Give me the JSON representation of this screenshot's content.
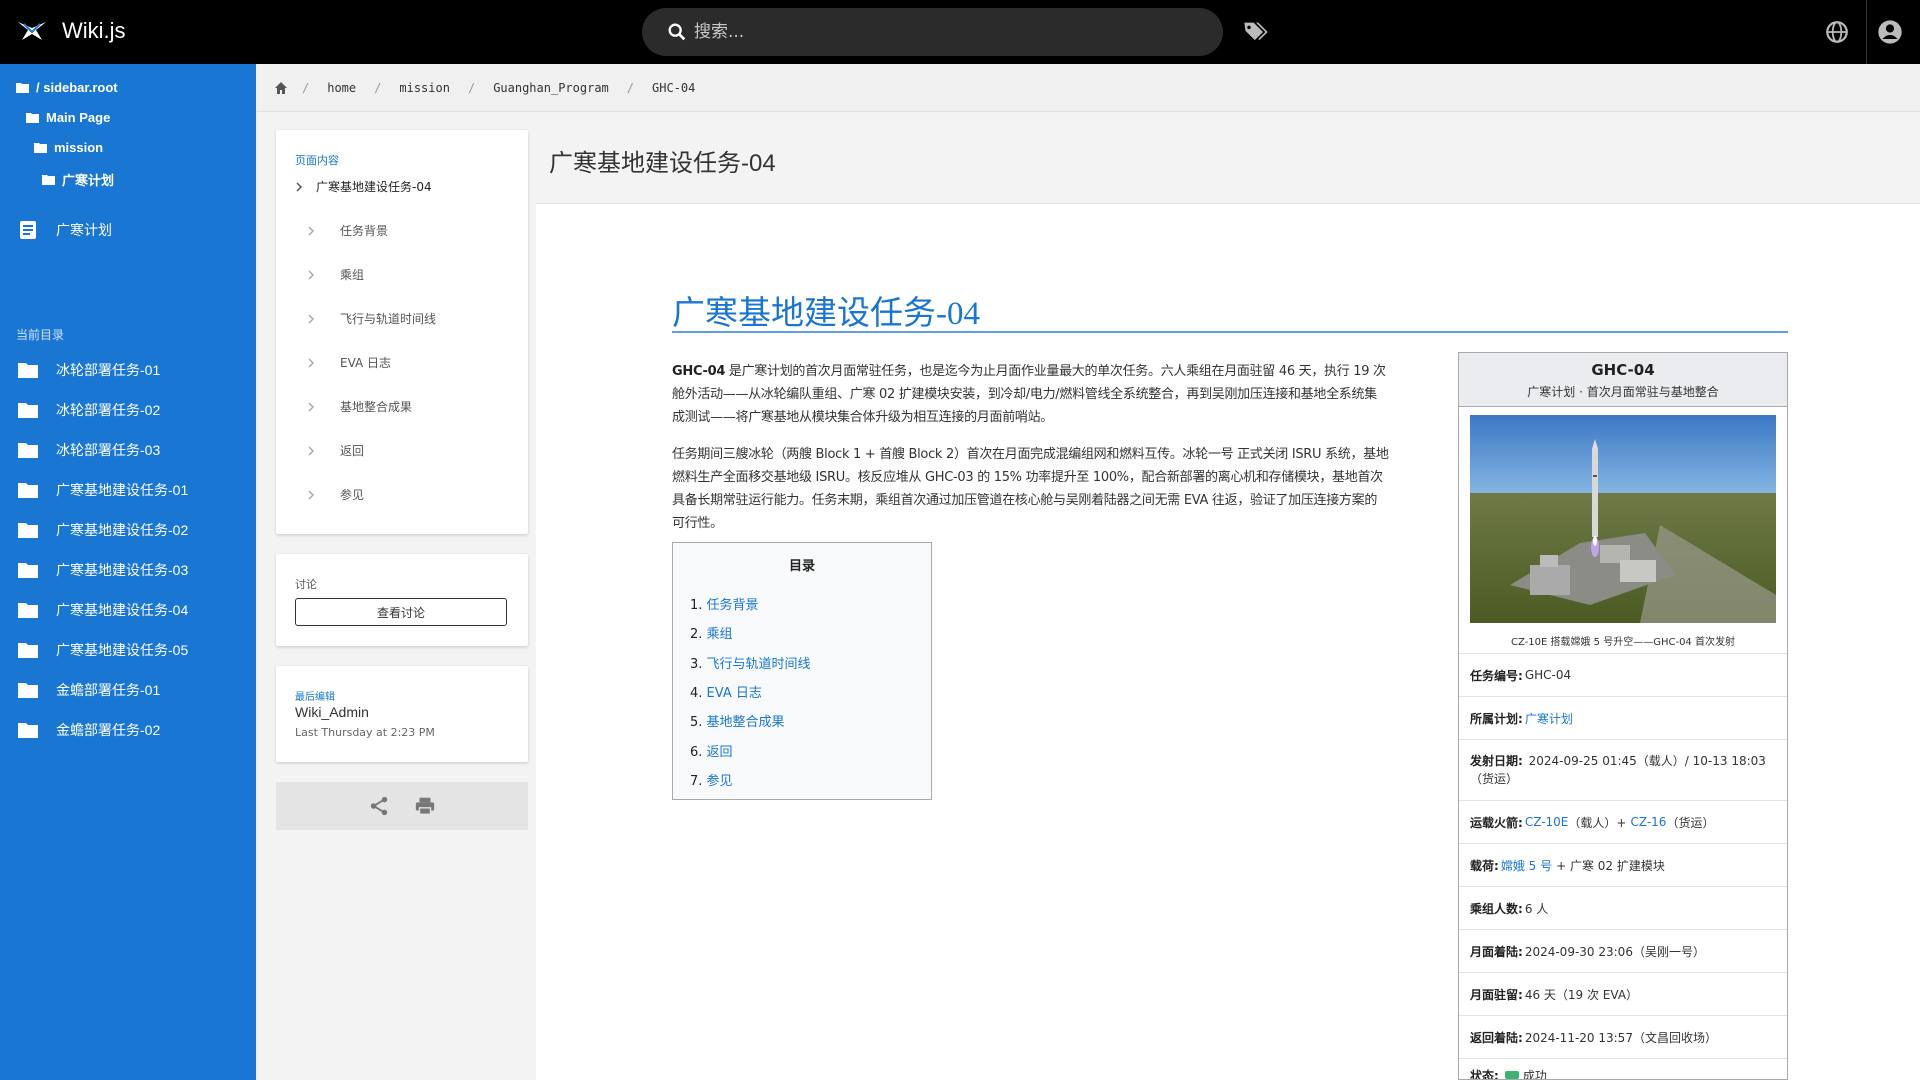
{
  "app": {
    "title": "Wiki.js"
  },
  "search": {
    "placeholder": "搜索..."
  },
  "sidebar": {
    "tree": [
      "/ sidebar.root",
      "Main Page",
      "mission",
      "广寒计划"
    ],
    "pinned": "广寒计划",
    "section_title": "当前目录",
    "items": [
      "冰轮部署任务-01",
      "冰轮部署任务-02",
      "冰轮部署任务-03",
      "广寒基地建设任务-01",
      "广寒基地建设任务-02",
      "广寒基地建设任务-03",
      "广寒基地建设任务-04",
      "广寒基地建设任务-05",
      "金蟾部署任务-01",
      "金蟾部署任务-02"
    ]
  },
  "breadcrumb": [
    "home",
    "mission",
    "Guanghan_Program",
    "GHC-04"
  ],
  "page_title": "广寒基地建设任务-04",
  "toc_panel": {
    "heading": "页面内容",
    "main": "广寒基地建设任务-04",
    "items": [
      "任务背景",
      "乘组",
      "飞行与轨道时间线",
      "EVA 日志",
      "基地整合成果",
      "返回",
      "参见"
    ]
  },
  "discussion": {
    "heading": "讨论",
    "button": "查看讨论"
  },
  "last_edit": {
    "heading": "最后编辑",
    "user": "Wiki_Admin",
    "time": "Last Thursday at 2:23 PM"
  },
  "article": {
    "heading": "广寒基地建设任务-04",
    "p1_bold": "GHC-04",
    "p1_line1": " 是广寒计划的首次月面常驻任务，也是迄今为止月面作业量最大的单次任务。六人乘组在月面驻留 46 天，执行 19 次",
    "p1_line2": "舱外活动——从冰轮编队重组、广寒 02 扩建模块安装，到冷却/电力/燃料管线全系统整合，再到吴刚加压连接和基地全系统集",
    "p1_line3": "成测试——将广寒基地从模块集合体升级为相互连接的月面前哨站。",
    "p2_line1": "任务期间三艘冰轮（两艘 Block 1 + 首艘 Block 2）首次在月面完成混编组网和燃料互传。冰轮一号 正式关闭 ISRU 系统，基地",
    "p2_line2": "燃料生产全面移交基地级 ISRU。核反应堆从 GHC-03 的 15% 功率提升至 100%，配合新部署的离心机和存储模块，基地首次",
    "p2_line3": "具备长期常驻运行能力。任务末期，乘组首次通过加压管道在核心舱与吴刚着陆器之间无需 EVA 往返，验证了加压连接方案的",
    "p2_line4": "可行性。",
    "toc_title": "目录",
    "toc": [
      {
        "num": "1.",
        "label": "任务背景"
      },
      {
        "num": "2.",
        "label": "乘组"
      },
      {
        "num": "3.",
        "label": "飞行与轨道时间线"
      },
      {
        "num": "4.",
        "label": "EVA 日志"
      },
      {
        "num": "5.",
        "label": "基地整合成果"
      },
      {
        "num": "6.",
        "label": "返回"
      },
      {
        "num": "7.",
        "label": "参见"
      }
    ]
  },
  "infobox": {
    "code": "GHC-04",
    "subtitle": "广寒计划 · 首次月面常驻与基地整合",
    "caption": "CZ-10E 搭载嫦娥 5 号升空——GHC-04 首次发射",
    "rows": {
      "mission_no": {
        "label": "任务编号:",
        "value": "GHC-04"
      },
      "program": {
        "label": "所属计划:",
        "link": "广寒计划"
      },
      "launch": {
        "label": "发射日期:",
        "value": "2024-09-25 01:45（载人）/ 10-13 18:03",
        "value2": "（货运）"
      },
      "rocket": {
        "label": "运载火箭:",
        "link1": "CZ-10E",
        "text1": "（载人）+",
        "link2": "CZ-16",
        "text2": "（货运）"
      },
      "payload": {
        "label": "载荷:",
        "link": "嫦娥 5 号",
        "value": "+ 广寒 02 扩建模块"
      },
      "crew": {
        "label": "乘组人数:",
        "value": "6 人"
      },
      "landing": {
        "label": "月面着陆:",
        "value": "2024-09-30 23:06（吴刚一号）"
      },
      "stay": {
        "label": "月面驻留:",
        "value": "46 天（19 次 EVA）"
      },
      "return": {
        "label": "返回着陆:",
        "value": "2024-11-20 13:57（文昌回收场）"
      },
      "status": {
        "label": "状态:",
        "value": "成功"
      }
    }
  },
  "colors": {
    "accent": "#1976d2",
    "topbar": "#000000",
    "sidebar": "#1976d2",
    "success": "#3cb371"
  }
}
